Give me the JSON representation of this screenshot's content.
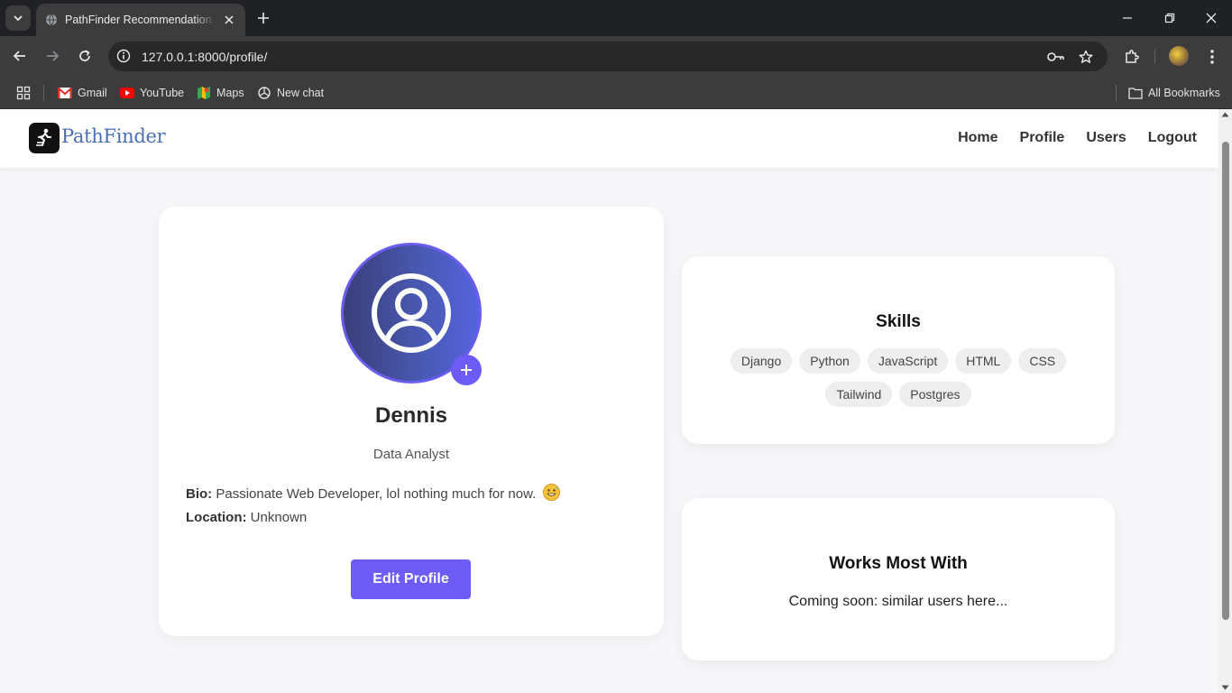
{
  "browser": {
    "tab_title": "PathFinder Recommendation Sy",
    "url_host": "127.0.0.1",
    "url_path": ":8000/profile/",
    "bookmarks": [
      "Gmail",
      "YouTube",
      "Maps",
      "New chat"
    ],
    "all_bookmarks": "All Bookmarks"
  },
  "site": {
    "logo_text": "PathFinder",
    "nav": [
      "Home",
      "Profile",
      "Users",
      "Logout"
    ]
  },
  "profile": {
    "name": "Dennis",
    "role": "Data Analyst",
    "bio_label": "Bio:",
    "bio": "Passionate Web Developer, lol nothing much for now.",
    "location_label": "Location:",
    "location": "Unknown",
    "edit_button": "Edit Profile"
  },
  "skills": {
    "title": "Skills",
    "items": [
      "Django",
      "Python",
      "JavaScript",
      "HTML",
      "CSS",
      "Tailwind",
      "Postgres"
    ]
  },
  "works_with": {
    "title": "Works Most With",
    "text": "Coming soon: similar users here..."
  },
  "colors": {
    "accent": "#6c5cf5",
    "logo": "#4a6fb5"
  }
}
